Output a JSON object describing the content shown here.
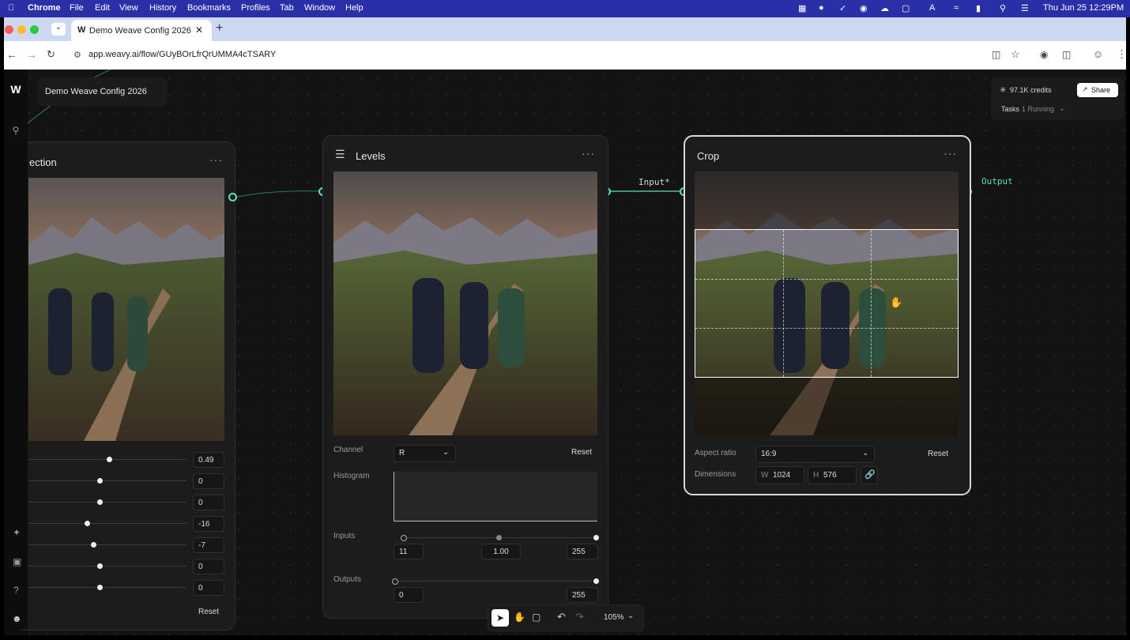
{
  "menubar": {
    "app": "Chrome",
    "items": [
      "File",
      "Edit",
      "View",
      "History",
      "Bookmarks",
      "Profiles",
      "Tab",
      "Window",
      "Help"
    ],
    "datetime": "Thu Jun 25  12:29PM"
  },
  "browser": {
    "tab_title": "Demo Weave Config 2026",
    "url": "app.weavy.ai/flow/GUyBOrLfrQrUMMA4cTSARY"
  },
  "workspace": {
    "name": "Demo Weave Config 2026",
    "credits": "97.1K credits",
    "share_label": "Share",
    "tasks_label": "Tasks",
    "tasks_status": "1 Running"
  },
  "node_left": {
    "title_fragment": "ection",
    "values": [
      "0.49",
      "0",
      "0",
      "-16",
      "-7",
      "0",
      "0"
    ],
    "knob_positions": [
      0.51,
      0.45,
      0.45,
      0.37,
      0.41,
      0.45,
      0.45
    ],
    "reset_label": "Reset"
  },
  "node_levels": {
    "title": "Levels",
    "channel_label": "Channel",
    "channel_value": "R",
    "reset_label": "Reset",
    "histogram_label": "Histogram",
    "inputs_label": "Inputs",
    "inputs": [
      "11",
      "1.00",
      "255"
    ],
    "outputs_label": "Outputs",
    "outputs": [
      "0",
      "255"
    ]
  },
  "node_crop": {
    "title": "Crop",
    "input_port_label": "Input*",
    "output_port_label": "Output",
    "aspect_label": "Aspect ratio",
    "aspect_value": "16:9",
    "reset_label": "Reset",
    "dimensions_label": "Dimensions",
    "w_label": "W",
    "w_value": "1024",
    "h_label": "H",
    "h_value": "576"
  },
  "toolbar": {
    "zoom": "105%"
  },
  "colors": {
    "accent": "#5ee0b6",
    "canvas_bg": "#131313",
    "node_bg": "#1c1c1c"
  }
}
